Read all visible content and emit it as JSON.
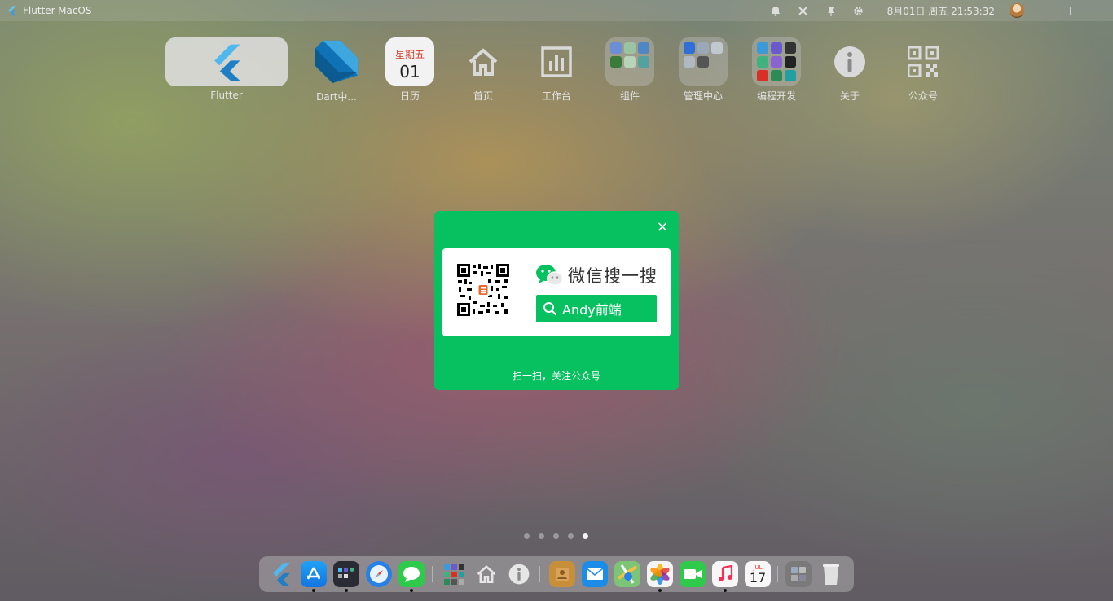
{
  "window": {
    "title": "Flutter-MacOS"
  },
  "topbar": {
    "icons": [
      "bell-icon",
      "tools-icon",
      "pin-icon",
      "gear-icon"
    ],
    "clock": "8月01日 周五 21:53:32"
  },
  "launcher": {
    "apps": [
      {
        "label": "Flutter"
      },
      {
        "label": "Dart中..."
      },
      {
        "label": "日历",
        "weekday": "星期五",
        "day": "01"
      },
      {
        "label": "首页"
      },
      {
        "label": "工作台"
      },
      {
        "label": "组件"
      },
      {
        "label": "管理中心"
      },
      {
        "label": "编程开发"
      },
      {
        "label": "关于"
      },
      {
        "label": "公众号"
      }
    ]
  },
  "dialog": {
    "close": "×",
    "wechat_search": "微信搜一搜",
    "account": "Andy前端",
    "hint": "扫一扫，关注公众号",
    "brand_color": "#07c160"
  },
  "pager": {
    "count": 5,
    "active": 5
  },
  "dock": {
    "apps": [
      "flutter",
      "app-store",
      "launchpad",
      "safari",
      "messages",
      "apps-folder",
      "home",
      "info",
      "contacts",
      "mail",
      "maps",
      "photos",
      "facetime",
      "music",
      "calendar",
      "tools",
      "trash"
    ],
    "calendar_month": "JUL",
    "calendar_day": "17"
  }
}
